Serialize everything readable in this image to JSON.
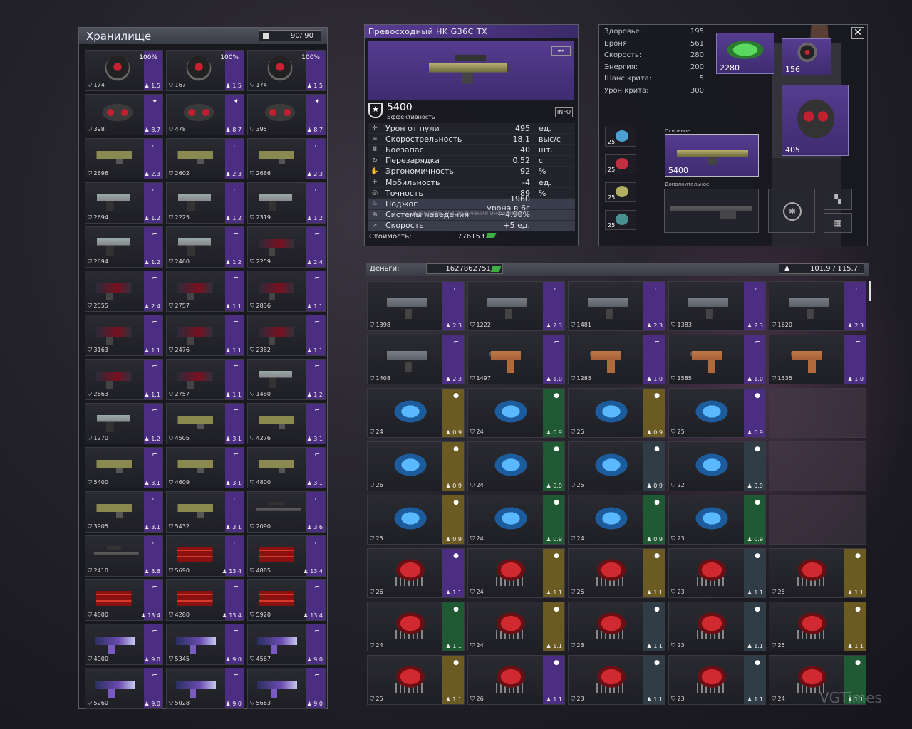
{
  "storage": {
    "title": "Хранилище",
    "capacity": "90/ 90",
    "items": [
      {
        "art": "helmet",
        "lv": "174",
        "wt": "1.5",
        "ic": "100%"
      },
      {
        "art": "helmet",
        "lv": "167",
        "wt": "1.5",
        "ic": "100%"
      },
      {
        "art": "helmet",
        "lv": "174",
        "wt": "1.5",
        "ic": "100%"
      },
      {
        "art": "vest",
        "lv": "398",
        "wt": "8.7",
        "ic": "✦"
      },
      {
        "art": "vest",
        "lv": "478",
        "wt": "8.7",
        "ic": "✦"
      },
      {
        "art": "vest",
        "lv": "395",
        "wt": "8.7",
        "ic": "✦"
      },
      {
        "art": "camo",
        "lv": "2696",
        "wt": "2.3",
        "ic": "⌐"
      },
      {
        "art": "camo",
        "lv": "2602",
        "wt": "2.3",
        "ic": "⌐"
      },
      {
        "art": "camo",
        "lv": "2666",
        "wt": "2.3",
        "ic": "⌐"
      },
      {
        "art": "pistol",
        "lv": "2694",
        "wt": "1.2",
        "ic": "⌐"
      },
      {
        "art": "pistol",
        "lv": "2225",
        "wt": "1.2",
        "ic": "⌐"
      },
      {
        "art": "pistol",
        "lv": "2319",
        "wt": "1.2",
        "ic": "⌐"
      },
      {
        "art": "pistol",
        "lv": "2694",
        "wt": "1.2",
        "ic": "⌐"
      },
      {
        "art": "pistol",
        "lv": "2460",
        "wt": "1.2",
        "ic": "⌐"
      },
      {
        "art": "red",
        "lv": "2259",
        "wt": "2.4",
        "ic": "⌐"
      },
      {
        "art": "red",
        "lv": "2555",
        "wt": "2.4",
        "ic": "⌐"
      },
      {
        "art": "red",
        "lv": "2757",
        "wt": "1.1",
        "ic": "⌐"
      },
      {
        "art": "red",
        "lv": "2836",
        "wt": "1.1",
        "ic": "⌐"
      },
      {
        "art": "red",
        "lv": "3163",
        "wt": "1.1",
        "ic": "⌐"
      },
      {
        "art": "red",
        "lv": "2476",
        "wt": "1.1",
        "ic": "⌐"
      },
      {
        "art": "red",
        "lv": "2382",
        "wt": "1.1",
        "ic": "⌐"
      },
      {
        "art": "red",
        "lv": "2663",
        "wt": "1.1",
        "ic": "⌐"
      },
      {
        "art": "red",
        "lv": "2757",
        "wt": "1.1",
        "ic": "⌐"
      },
      {
        "art": "pistol",
        "lv": "1480",
        "wt": "1.2",
        "ic": "⌐"
      },
      {
        "art": "pistol",
        "lv": "1270",
        "wt": "1.2",
        "ic": "⌐"
      },
      {
        "art": "camo",
        "lv": "4505",
        "wt": "3.1",
        "ic": "⌐"
      },
      {
        "art": "camo",
        "lv": "4276",
        "wt": "3.1",
        "ic": "⌐"
      },
      {
        "art": "camo",
        "lv": "5400",
        "wt": "3.1",
        "ic": "⌐"
      },
      {
        "art": "camo",
        "lv": "4609",
        "wt": "3.1",
        "ic": "⌐"
      },
      {
        "art": "camo",
        "lv": "4800",
        "wt": "3.1",
        "ic": "⌐"
      },
      {
        "art": "camo",
        "lv": "3905",
        "wt": "3.1",
        "ic": "⌐"
      },
      {
        "art": "camo",
        "lv": "5432",
        "wt": "3.1",
        "ic": "⌐"
      },
      {
        "art": "sniper",
        "lv": "2090",
        "wt": "3.6",
        "ic": "⌐"
      },
      {
        "art": "sniper",
        "lv": "2410",
        "wt": "3.6",
        "ic": "⌐"
      },
      {
        "art": "mini",
        "lv": "5690",
        "wt": "13.4",
        "ic": "⌐"
      },
      {
        "art": "mini",
        "lv": "4885",
        "wt": "13.4",
        "ic": "⌐"
      },
      {
        "art": "mini",
        "lv": "4800",
        "wt": "13.4",
        "ic": "⌐"
      },
      {
        "art": "mini",
        "lv": "4280",
        "wt": "13.4",
        "ic": "⌐"
      },
      {
        "art": "mini",
        "lv": "5920",
        "wt": "13.4",
        "ic": "⌐"
      },
      {
        "art": "purple",
        "lv": "4900",
        "wt": "9.0",
        "ic": "⌐"
      },
      {
        "art": "purple",
        "lv": "5345",
        "wt": "9.0",
        "ic": "⌐"
      },
      {
        "art": "purple",
        "lv": "4567",
        "wt": "9.0",
        "ic": "⌐"
      },
      {
        "art": "purple",
        "lv": "5260",
        "wt": "9.0",
        "ic": "⌐"
      },
      {
        "art": "purple",
        "lv": "5028",
        "wt": "9.0",
        "ic": "⌐"
      },
      {
        "art": "purple",
        "lv": "5663",
        "wt": "9.0",
        "ic": "⌐"
      }
    ]
  },
  "info": {
    "title": "Превосходный  HK  G36C  TX",
    "eff_value": "5400",
    "eff_label": "Эффективность",
    "info_btn": "INFO",
    "hint": "Наведите для получения информации.",
    "cost_label": "Стоимость:",
    "cost_value": "776153",
    "stats": [
      {
        "n": "Урон  от  пули",
        "v": "495",
        "u": "ед."
      },
      {
        "n": "Скорострельность",
        "v": "18.1",
        "u": "выс/с"
      },
      {
        "n": "Боезапас",
        "v": "40",
        "u": "шт."
      },
      {
        "n": "Перезарядка",
        "v": "0.52",
        "u": "с"
      },
      {
        "n": "Эргономичность",
        "v": "92",
        "u": "%"
      },
      {
        "n": "Мобильность",
        "v": "-4",
        "u": "ед."
      },
      {
        "n": "Точность",
        "v": "89",
        "u": "%"
      },
      {
        "n": "Поджог",
        "v": "1960  урона  в  6с",
        "u": ""
      },
      {
        "n": "Системы  наведения",
        "v": "+4.90%",
        "u": ""
      },
      {
        "n": "Скорость",
        "v": "+5  ед.",
        "u": ""
      }
    ]
  },
  "char": {
    "stats": [
      {
        "n": "Здоровье:",
        "v": "195"
      },
      {
        "n": "Броня:",
        "v": "561"
      },
      {
        "n": "Скорость:",
        "v": "280"
      },
      {
        "n": "Энергия:",
        "v": "200"
      },
      {
        "n": "Шанс  крита:",
        "v": "5"
      },
      {
        "n": "Урон  крита:",
        "v": "300"
      }
    ],
    "slot_top1": "2280",
    "slot_top2": "156",
    "slot_vest": "405",
    "primary_label": "Основное",
    "primary_value": "5400",
    "secondary_label": "Дополнительное",
    "side": [
      "25",
      "25",
      "25",
      "25"
    ]
  },
  "money": {
    "label": "Деньги:",
    "value": "1627862751",
    "weight": "101.9 / 115.7"
  },
  "inventory": [
    {
      "art": "smg",
      "lv": "1398",
      "wt": "2.3",
      "s": ""
    },
    {
      "art": "smg",
      "lv": "1222",
      "wt": "2.3",
      "s": ""
    },
    {
      "art": "smg",
      "lv": "1481",
      "wt": "2.3",
      "s": ""
    },
    {
      "art": "smg",
      "lv": "1383",
      "wt": "2.3",
      "s": ""
    },
    {
      "art": "smg",
      "lv": "1620",
      "wt": "2.3",
      "s": ""
    },
    {
      "art": "smg",
      "lv": "1408",
      "wt": "2.3",
      "s": ""
    },
    {
      "art": "tan",
      "lv": "1497",
      "wt": "1.0",
      "s": ""
    },
    {
      "art": "tan",
      "lv": "1285",
      "wt": "1.0",
      "s": ""
    },
    {
      "art": "tan",
      "lv": "1585",
      "wt": "1.0",
      "s": ""
    },
    {
      "art": "tan",
      "lv": "1335",
      "wt": "1.0",
      "s": ""
    },
    {
      "art": "grenade",
      "lv": "24",
      "wt": "0.9",
      "s": "y"
    },
    {
      "art": "grenade",
      "lv": "24",
      "wt": "0.9",
      "s": "g"
    },
    {
      "art": "grenade",
      "lv": "25",
      "wt": "0.9",
      "s": "y"
    },
    {
      "art": "grenade",
      "lv": "25",
      "wt": "0.9",
      "s": ""
    },
    {
      "art": "empty"
    },
    {
      "art": "grenade",
      "lv": "26",
      "wt": "0.9",
      "s": "y"
    },
    {
      "art": "grenade",
      "lv": "24",
      "wt": "0.9",
      "s": "g"
    },
    {
      "art": "grenade",
      "lv": "25",
      "wt": "0.9",
      "s": "s"
    },
    {
      "art": "grenade",
      "lv": "22",
      "wt": "0.9",
      "s": "s"
    },
    {
      "art": "empty"
    },
    {
      "art": "grenade",
      "lv": "25",
      "wt": "0.9",
      "s": "y"
    },
    {
      "art": "grenade",
      "lv": "24",
      "wt": "0.9",
      "s": "g"
    },
    {
      "art": "grenade",
      "lv": "24",
      "wt": "0.9",
      "s": "g"
    },
    {
      "art": "grenade",
      "lv": "23",
      "wt": "0.9",
      "s": "g"
    },
    {
      "art": "empty"
    },
    {
      "art": "vest2",
      "lv": "26",
      "wt": "1.1",
      "s": ""
    },
    {
      "art": "vest2",
      "lv": "24",
      "wt": "1.1",
      "s": "y"
    },
    {
      "art": "vest2",
      "lv": "25",
      "wt": "1.1",
      "s": "y"
    },
    {
      "art": "vest2",
      "lv": "23",
      "wt": "1.1",
      "s": "s"
    },
    {
      "art": "vest2",
      "lv": "25",
      "wt": "1.1",
      "s": "y"
    },
    {
      "art": "vest2",
      "lv": "24",
      "wt": "1.1",
      "s": "g"
    },
    {
      "art": "vest2",
      "lv": "24",
      "wt": "1.1",
      "s": "y"
    },
    {
      "art": "vest2",
      "lv": "23",
      "wt": "1.1",
      "s": "s"
    },
    {
      "art": "vest2",
      "lv": "23",
      "wt": "1.1",
      "s": "s"
    },
    {
      "art": "vest2",
      "lv": "25",
      "wt": "1.1",
      "s": "y"
    },
    {
      "art": "vest2",
      "lv": "25",
      "wt": "1.1",
      "s": "y"
    },
    {
      "art": "vest2",
      "lv": "26",
      "wt": "1.1",
      "s": ""
    },
    {
      "art": "vest2",
      "lv": "23",
      "wt": "1.1",
      "s": "s"
    },
    {
      "art": "vest2",
      "lv": "23",
      "wt": "1.1",
      "s": "s"
    },
    {
      "art": "vest2",
      "lv": "24",
      "wt": "1.1",
      "s": "g"
    }
  ],
  "watermark": "VGTimes"
}
